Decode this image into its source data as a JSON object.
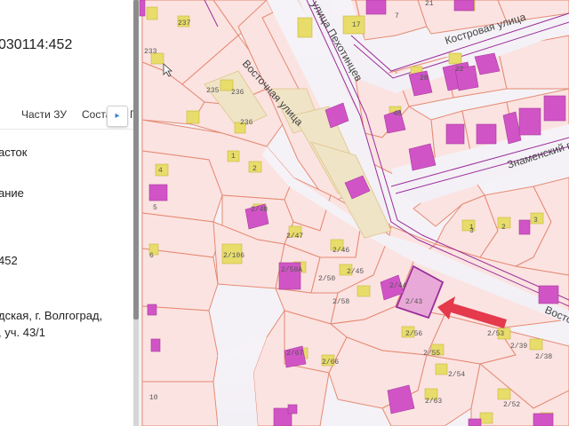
{
  "panel": {
    "cadastral_number": "030114:452",
    "tabs": [
      "Части ЗУ",
      "Соста",
      "Г"
    ],
    "next_tab_icon": "▸",
    "lines": [
      "асток",
      "ание",
      "452",
      "дская, г. Волгоград,",
      ", уч. 43/1"
    ]
  },
  "map": {
    "streets": [
      "Восточная улица",
      "улица Пехотинцев",
      "Костровая улица",
      "Знаменский п",
      "Восточная улица",
      "Восто"
    ],
    "lot_labels": [
      "237",
      "233",
      "235",
      "236",
      "236",
      "1",
      "2",
      "2/48",
      "4",
      "5",
      "2/47",
      "2/46",
      "2/106",
      "2/45",
      "2/59А",
      "2/50",
      "2/44",
      "2/58",
      "2/43",
      "6",
      "2/56",
      "2/55",
      "2/54",
      "2/53",
      "2/38",
      "2/39",
      "2/67",
      "2/66",
      "2/63",
      "2/52",
      "10",
      "17",
      "21",
      "28",
      "22",
      "48",
      "3",
      "3",
      "2",
      "1",
      "7"
    ],
    "highlighted_lot": "2/43",
    "colors": {
      "parcel_fill": "#fbe3e1",
      "parcel_stroke": "#e58a73",
      "building": "#d154c6",
      "highlight": "#e9a9d8",
      "arrow": "#e43a4c",
      "land_fill": "#efe4c6",
      "boundary": "#9b2d99"
    }
  }
}
